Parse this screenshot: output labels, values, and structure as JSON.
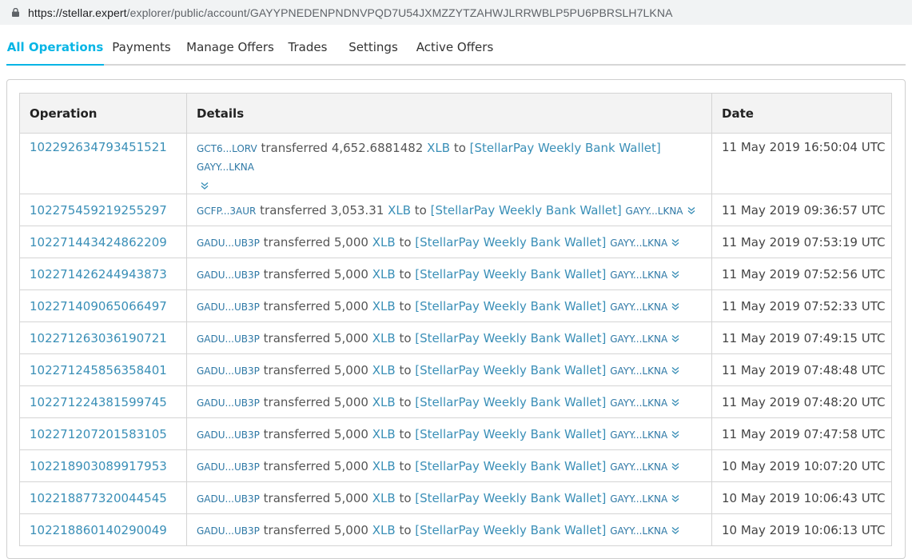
{
  "browser": {
    "url_host": "https://stellar.expert",
    "url_path": "/explorer/public/account/GAYYPNEDENPNDNVPQD7U54JXMZZYTZAHWJLRRWBLP5PU6PBRSLH7LKNA"
  },
  "tabs": [
    {
      "label": "All Operations"
    },
    {
      "label": "Payments"
    },
    {
      "label": "Manage Offers"
    },
    {
      "label": "Trades"
    },
    {
      "label": "Settings"
    },
    {
      "label": "Active Offers"
    }
  ],
  "table": {
    "headers": [
      "Operation",
      "Details",
      "Date"
    ],
    "rows": [
      {
        "op": "102292634793451521",
        "from": "GCT6...LORV",
        "verb": "transferred",
        "amount": "4,652.6881482",
        "asset": "XLB",
        "to_word": "to",
        "dest_name": "[StellarPay Weekly Bank Wallet]",
        "dest_acct": "GAYY...LKNA",
        "date": "11 May 2019 16:50:04 UTC"
      },
      {
        "op": "102275459219255297",
        "from": "GCFP...3AUR",
        "verb": "transferred",
        "amount": "3,053.31",
        "asset": "XLB",
        "to_word": "to",
        "dest_name": "[StellarPay Weekly Bank Wallet]",
        "dest_acct": "GAYY...LKNA",
        "date": "11 May 2019 09:36:57 UTC"
      },
      {
        "op": "102271443424862209",
        "from": "GADU...UB3P",
        "verb": "transferred",
        "amount": "5,000",
        "asset": "XLB",
        "to_word": "to",
        "dest_name": "[StellarPay Weekly Bank Wallet]",
        "dest_acct": "GAYY...LKNA",
        "date": "11 May 2019 07:53:19 UTC"
      },
      {
        "op": "102271426244943873",
        "from": "GADU...UB3P",
        "verb": "transferred",
        "amount": "5,000",
        "asset": "XLB",
        "to_word": "to",
        "dest_name": "[StellarPay Weekly Bank Wallet]",
        "dest_acct": "GAYY...LKNA",
        "date": "11 May 2019 07:52:56 UTC"
      },
      {
        "op": "102271409065066497",
        "from": "GADU...UB3P",
        "verb": "transferred",
        "amount": "5,000",
        "asset": "XLB",
        "to_word": "to",
        "dest_name": "[StellarPay Weekly Bank Wallet]",
        "dest_acct": "GAYY...LKNA",
        "date": "11 May 2019 07:52:33 UTC"
      },
      {
        "op": "102271263036190721",
        "from": "GADU...UB3P",
        "verb": "transferred",
        "amount": "5,000",
        "asset": "XLB",
        "to_word": "to",
        "dest_name": "[StellarPay Weekly Bank Wallet]",
        "dest_acct": "GAYY...LKNA",
        "date": "11 May 2019 07:49:15 UTC"
      },
      {
        "op": "102271245856358401",
        "from": "GADU...UB3P",
        "verb": "transferred",
        "amount": "5,000",
        "asset": "XLB",
        "to_word": "to",
        "dest_name": "[StellarPay Weekly Bank Wallet]",
        "dest_acct": "GAYY...LKNA",
        "date": "11 May 2019 07:48:48 UTC"
      },
      {
        "op": "102271224381599745",
        "from": "GADU...UB3P",
        "verb": "transferred",
        "amount": "5,000",
        "asset": "XLB",
        "to_word": "to",
        "dest_name": "[StellarPay Weekly Bank Wallet]",
        "dest_acct": "GAYY...LKNA",
        "date": "11 May 2019 07:48:20 UTC"
      },
      {
        "op": "102271207201583105",
        "from": "GADU...UB3P",
        "verb": "transferred",
        "amount": "5,000",
        "asset": "XLB",
        "to_word": "to",
        "dest_name": "[StellarPay Weekly Bank Wallet]",
        "dest_acct": "GAYY...LKNA",
        "date": "11 May 2019 07:47:58 UTC"
      },
      {
        "op": "102218903089917953",
        "from": "GADU...UB3P",
        "verb": "transferred",
        "amount": "5,000",
        "asset": "XLB",
        "to_word": "to",
        "dest_name": "[StellarPay Weekly Bank Wallet]",
        "dest_acct": "GAYY...LKNA",
        "date": "10 May 2019 10:07:20 UTC"
      },
      {
        "op": "102218877320044545",
        "from": "GADU...UB3P",
        "verb": "transferred",
        "amount": "5,000",
        "asset": "XLB",
        "to_word": "to",
        "dest_name": "[StellarPay Weekly Bank Wallet]",
        "dest_acct": "GAYY...LKNA",
        "date": "10 May 2019 10:06:43 UTC"
      },
      {
        "op": "102218860140290049",
        "from": "GADU...UB3P",
        "verb": "transferred",
        "amount": "5,000",
        "asset": "XLB",
        "to_word": "to",
        "dest_name": "[StellarPay Weekly Bank Wallet]",
        "dest_acct": "GAYY...LKNA",
        "date": "10 May 2019 10:06:13 UTC"
      }
    ]
  },
  "colors": {
    "accent": "#08b5e5",
    "link": "#3a8fb7"
  }
}
